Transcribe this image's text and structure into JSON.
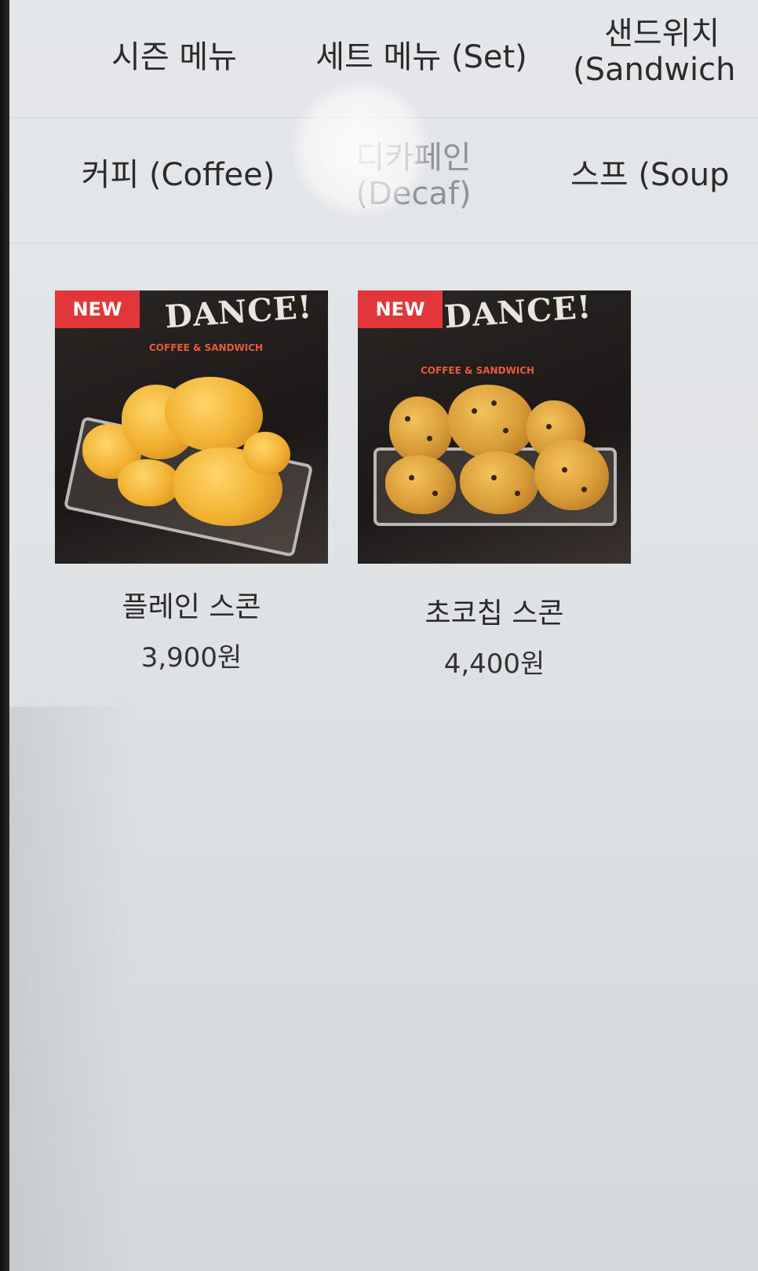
{
  "categories_row1": [
    {
      "label": "시즌 메뉴"
    },
    {
      "label": "세트 메뉴 (Set)"
    },
    {
      "label_line1": "샌드위치",
      "label_line2": "(Sandwich"
    }
  ],
  "categories_row2": [
    {
      "label": "커피 (Coffee)"
    },
    {
      "label_line1": "디카페인",
      "label_line2": "(Decaf)"
    },
    {
      "label": "스프 (Soup"
    }
  ],
  "products": [
    {
      "badge": "NEW",
      "name": "플레인 스콘",
      "price": "3,900원",
      "shirt_text": "DANCE!",
      "shirt_sub": "COFFEE & SANDWICH"
    },
    {
      "badge": "NEW",
      "name": "초코칩 스콘",
      "price": "4,400원",
      "shirt_text": "DANCE!",
      "shirt_sub": "COFFEE & SANDWICH"
    }
  ],
  "colors": {
    "badge": "#e2363b",
    "background": "#e1e4e6",
    "text": "#2b2b2b"
  }
}
